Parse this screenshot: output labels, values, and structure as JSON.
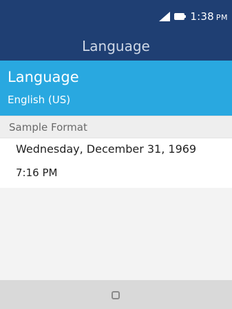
{
  "status_bar": {
    "time": "1:38",
    "ampm": "PM",
    "icons": [
      "signal-icon",
      "battery-icon"
    ]
  },
  "header": {
    "title": "Language"
  },
  "language_setting": {
    "label": "Language",
    "value": "English (US)"
  },
  "sample_format": {
    "header": "Sample Format",
    "date": "Wednesday, December 31, 1969",
    "time": "7:16 PM"
  },
  "bottom_bar": {
    "icon": "home-icon"
  },
  "colors": {
    "header_bg": "#1f3f73",
    "selected_bg": "#29a8e0",
    "bottom_bar_bg": "#d9d9d9"
  }
}
